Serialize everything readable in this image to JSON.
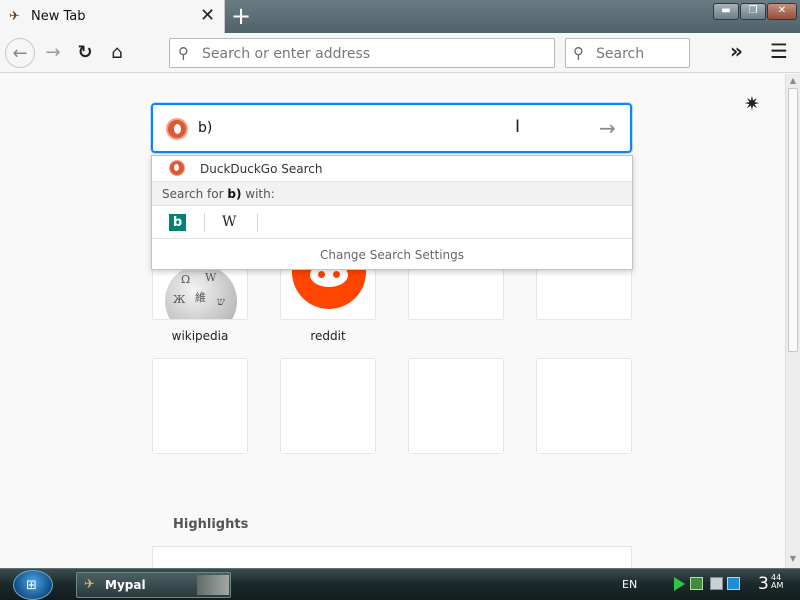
{
  "browser": {
    "tab": {
      "title": "New Tab",
      "close_label": "✕"
    },
    "new_tab_label": "+",
    "window_controls": {
      "minimize": "▬",
      "maximize": "❐",
      "close": "✕"
    },
    "nav": {
      "back": "←",
      "forward": "→",
      "reload": "↻",
      "home": "⌂",
      "url_placeholder": "Search or enter address",
      "search_placeholder": "Search",
      "overflow": "»",
      "menu": "☰"
    }
  },
  "newtab": {
    "settings_icon": "✷",
    "search": {
      "query": "b)",
      "submit": "→",
      "cursor": "I"
    },
    "dropdown": {
      "engine": "DuckDuckGo Search",
      "search_for_prefix": "Search for ",
      "search_for_query": "b)",
      "search_for_suffix": " with:",
      "engines": [
        {
          "name": "bing",
          "glyph": "b",
          "color": "#008373"
        },
        {
          "name": "wikipedia",
          "glyph": "W"
        }
      ],
      "change_settings": "Change Search Settings"
    },
    "top_sites": [
      {
        "label": "wikipedia"
      },
      {
        "label": "reddit"
      },
      {
        "label": ""
      },
      {
        "label": ""
      },
      {
        "label": ""
      },
      {
        "label": ""
      },
      {
        "label": ""
      },
      {
        "label": ""
      }
    ],
    "highlights_title": "Highlights"
  },
  "taskbar": {
    "app_label": "Mypal",
    "language": "EN",
    "clock_hour": "3",
    "clock_minutes": "44",
    "clock_ampm": "AM"
  },
  "colors": {
    "accent": "#0a84ff",
    "duckduckgo": "#de5833",
    "reddit": "#ff4500",
    "bing": "#008373"
  }
}
